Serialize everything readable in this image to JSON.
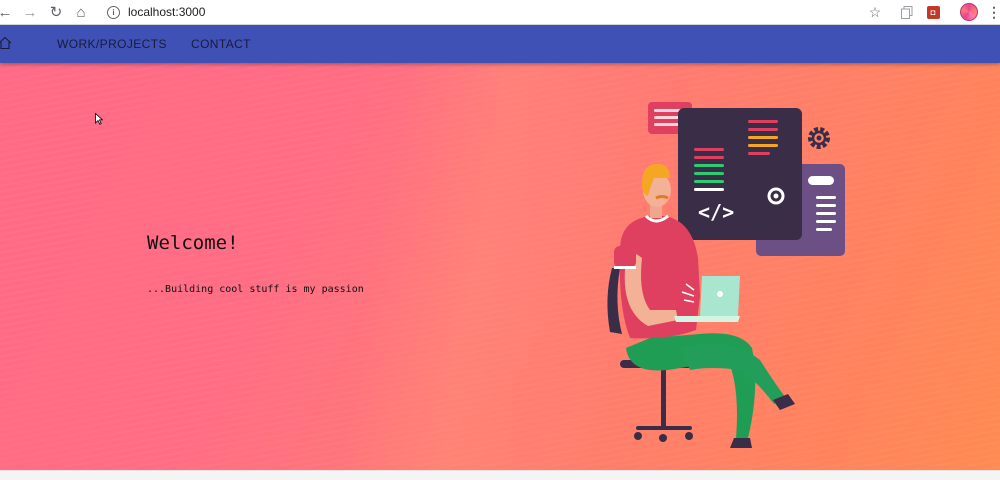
{
  "browser": {
    "url": "localhost:3000",
    "icons": [
      "back-icon",
      "forward-icon",
      "reload-icon",
      "home-icon",
      "info-icon",
      "star-icon",
      "copy-icon",
      "extension-icon",
      "profile-avatar",
      "menu-kebab-icon"
    ]
  },
  "navbar": {
    "background": "#3f51b5",
    "links": [
      {
        "label": "WORK/PROJECTS"
      },
      {
        "label": "CONTACT"
      }
    ]
  },
  "hero": {
    "title": "Welcome!",
    "subtitle": "...Building cool stuff is my passion",
    "gradient": [
      "#ff6a85",
      "#ff8a52"
    ],
    "illustration": "developer-on-laptop-illustration",
    "code_symbol": "</>"
  }
}
